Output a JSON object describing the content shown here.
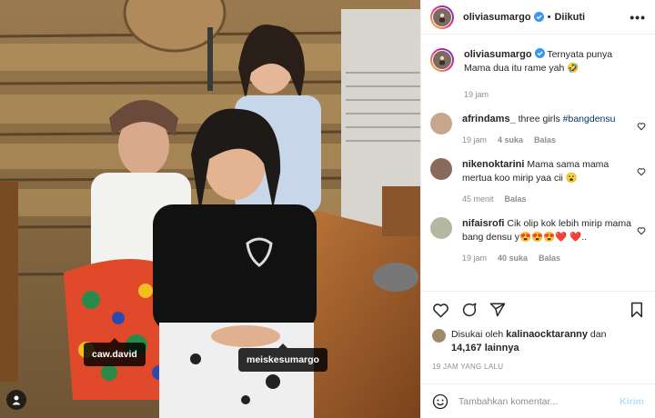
{
  "post": {
    "author": "oliviasumargo",
    "header_separator": "•",
    "follow_status": "Diikuti",
    "more_icon": "more-horizontal-icon",
    "photo_tags": [
      "caw.david",
      "meiskesumargo"
    ]
  },
  "caption": {
    "username": "oliviasumargo",
    "text": "Ternyata punya Mama dua itu rame yah 🤣",
    "time": "19 jam"
  },
  "comments": [
    {
      "username": "afrindams_",
      "text": "three girls",
      "hashtag": "#bangdensu",
      "time": "19 jam",
      "likes": "4 suka",
      "reply": "Balas",
      "avatar_color": "#c9a58a"
    },
    {
      "username": "nikenoktarini",
      "text": "Mama sama mama mertua koo mirip yaa cii 😮",
      "time": "45 menit",
      "reply": "Balas",
      "avatar_color": "#8a6a5a"
    },
    {
      "username": "nifaisrofi",
      "text": "Cik olip kok lebih mirip mama bang densu y😍😍😍❤️ ❤️..",
      "time": "19 jam",
      "likes": "40 suka",
      "reply": "Balas",
      "avatar_color": "#b5b8a0"
    }
  ],
  "likes": {
    "prefix": "Disukai oleh",
    "user": "kalinaocktaranny",
    "conj": "dan",
    "count": "14,167 lainnya"
  },
  "post_date": "19 JAM YANG LALU",
  "composer": {
    "placeholder": "Tambahkan komentar...",
    "post_label": "Kirim"
  },
  "colors": {
    "link": "#00376b",
    "muted": "#8e8e8e",
    "post_disabled": "#b2dffc",
    "verified": "#3897f0"
  }
}
